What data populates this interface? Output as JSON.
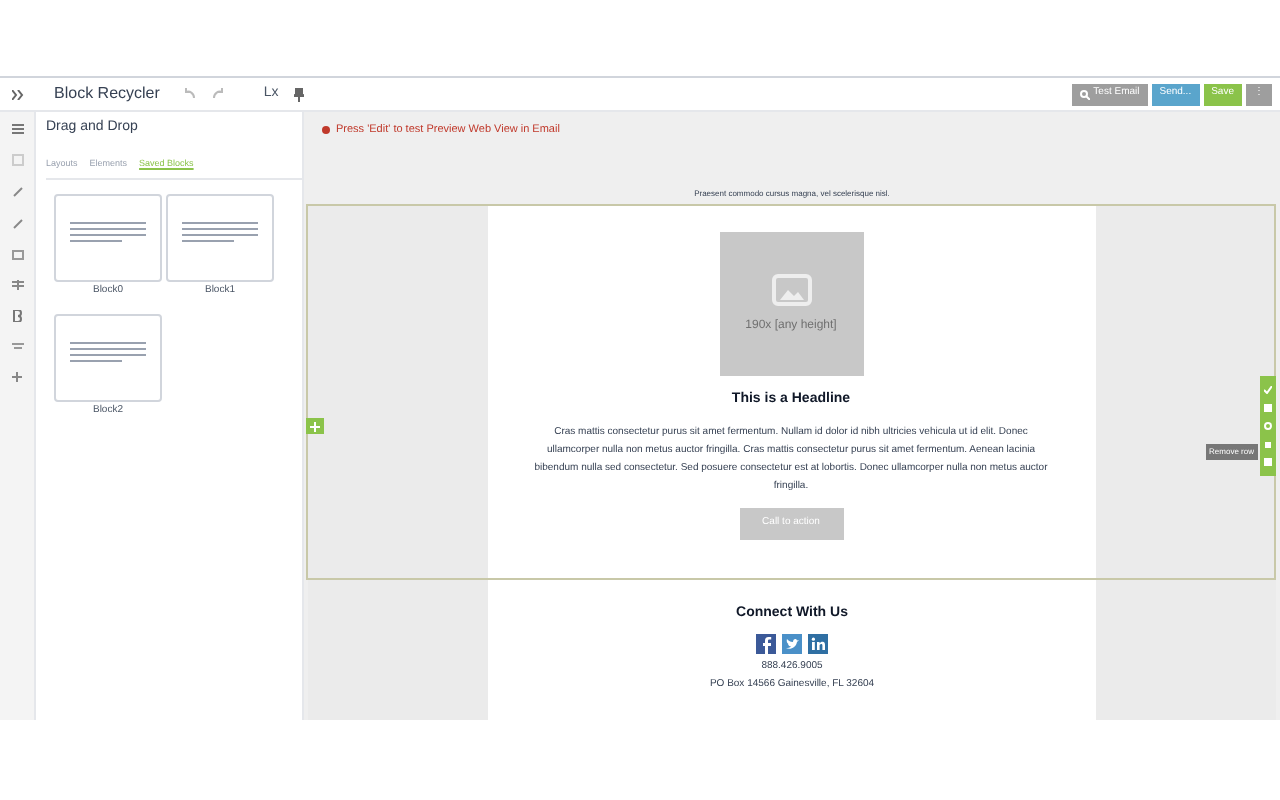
{
  "toolbar": {
    "title": "Block Recycler",
    "zoom": "Lx",
    "buttons": [
      {
        "label": "Test Email",
        "kind": "test"
      },
      {
        "label": "Send...",
        "kind": "send"
      },
      {
        "label": "Save",
        "kind": "save"
      },
      {
        "label": "⋮",
        "kind": "more"
      }
    ]
  },
  "sidebar": {
    "title": "Drag and Drop",
    "tabs": [
      {
        "label": "Layouts",
        "selected": false
      },
      {
        "label": "Elements",
        "selected": false
      },
      {
        "label": "Saved Blocks",
        "selected": true
      }
    ],
    "blocks": [
      {
        "name": "Block0"
      },
      {
        "name": "Block1"
      },
      {
        "name": "Block2"
      }
    ]
  },
  "notice": "Press 'Edit' to test Preview Web View in Email",
  "preheader": "Praesent commodo cursus magna, vel scelerisque nisl.",
  "content": {
    "image_caption": "190x [any height]",
    "headline": "This is a Headline",
    "body": "Cras mattis consectetur purus sit amet fermentum. Nullam id dolor id nibh ultricies vehicula ut id elit. Donec ullamcorper nulla non metus auctor fringilla. Cras mattis consectetur purus sit amet fermentum. Aenean lacinia bibendum nulla sed consectetur. Sed posuere consectetur est at lobortis. Donec ullamcorper nulla non metus auctor fringilla.",
    "button": "Call to action",
    "tooltip": "Remove row"
  },
  "footer": {
    "title": "Connect With Us",
    "phone": "888.426.9005",
    "address": "PO Box 14566 Gainesville, FL 32604"
  }
}
